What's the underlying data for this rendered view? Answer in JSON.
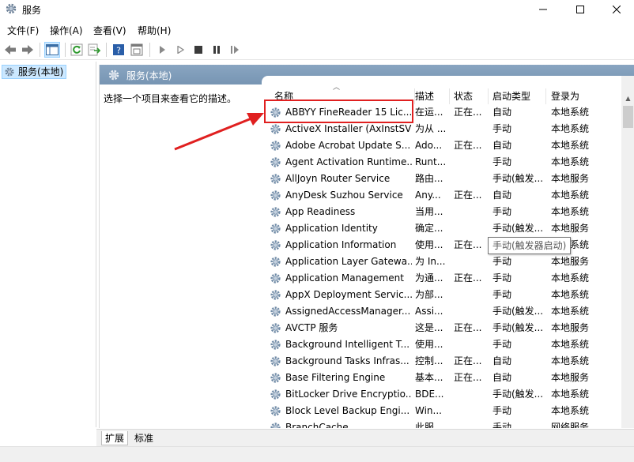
{
  "window": {
    "title": "服务",
    "icon": "services-gear-icon"
  },
  "menu": [
    "文件(F)",
    "操作(A)",
    "查看(V)",
    "帮助(H)"
  ],
  "tree": {
    "selected_label": "服务(本地)"
  },
  "panel": {
    "header": "服务(本地)",
    "description_hint": "选择一个项目来查看它的描述。"
  },
  "columns": [
    "名称",
    "描述",
    "状态",
    "启动类型",
    "登录为"
  ],
  "services": [
    {
      "name": "ABBYY FineReader 15 Lic...",
      "desc": "在运...",
      "status": "正在...",
      "startup": "自动",
      "logon": "本地系统"
    },
    {
      "name": "ActiveX Installer (AxInstSV)",
      "desc": "为从 ...",
      "status": "",
      "startup": "手动",
      "logon": "本地系统"
    },
    {
      "name": "Adobe Acrobat Update S...",
      "desc": "Ado...",
      "status": "正在...",
      "startup": "自动",
      "logon": "本地系统"
    },
    {
      "name": "Agent Activation Runtime...",
      "desc": "Runt...",
      "status": "",
      "startup": "手动",
      "logon": "本地系统"
    },
    {
      "name": "AllJoyn Router Service",
      "desc": "路由...",
      "status": "",
      "startup": "手动(触发...",
      "logon": "本地服务"
    },
    {
      "name": "AnyDesk Suzhou Service",
      "desc": "Any...",
      "status": "正在...",
      "startup": "自动",
      "logon": "本地系统"
    },
    {
      "name": "App Readiness",
      "desc": "当用...",
      "status": "",
      "startup": "手动",
      "logon": "本地系统"
    },
    {
      "name": "Application Identity",
      "desc": "确定...",
      "status": "",
      "startup": "手动(触发...",
      "logon": "本地服务"
    },
    {
      "name": "Application Information",
      "desc": "使用...",
      "status": "正在...",
      "startup": "手动(触发...",
      "logon": "本地系统"
    },
    {
      "name": "Application Layer Gatewa...",
      "desc": "为 In...",
      "status": "",
      "startup": "手动",
      "logon": "本地服务"
    },
    {
      "name": "Application Management",
      "desc": "为通...",
      "status": "正在...",
      "startup": "手动",
      "logon": "本地系统"
    },
    {
      "name": "AppX Deployment Servic...",
      "desc": "为部...",
      "status": "",
      "startup": "手动",
      "logon": "本地系统"
    },
    {
      "name": "AssignedAccessManager...",
      "desc": "Assi...",
      "status": "",
      "startup": "手动(触发...",
      "logon": "本地系统"
    },
    {
      "name": "AVCTP 服务",
      "desc": "这是...",
      "status": "正在...",
      "startup": "手动(触发...",
      "logon": "本地服务"
    },
    {
      "name": "Background Intelligent T...",
      "desc": "使用...",
      "status": "",
      "startup": "手动",
      "logon": "本地系统"
    },
    {
      "name": "Background Tasks Infras...",
      "desc": "控制...",
      "status": "正在...",
      "startup": "自动",
      "logon": "本地系统"
    },
    {
      "name": "Base Filtering Engine",
      "desc": "基本...",
      "status": "正在...",
      "startup": "自动",
      "logon": "本地服务"
    },
    {
      "name": "BitLocker Drive Encryptio...",
      "desc": "BDE...",
      "status": "",
      "startup": "手动(触发...",
      "logon": "本地系统"
    },
    {
      "name": "Block Level Backup Engi...",
      "desc": "Win...",
      "status": "",
      "startup": "手动",
      "logon": "本地系统"
    },
    {
      "name": "BranchCache",
      "desc": "此服...",
      "status": "",
      "startup": "手动",
      "logon": "网络服务"
    }
  ],
  "tooltip": "手动(触发器启动)",
  "tabs": [
    "扩展",
    "标准"
  ],
  "colors": {
    "header_bar": "#7f9db9",
    "selection": "#cce8ff",
    "annotation_red": "#e02020"
  }
}
